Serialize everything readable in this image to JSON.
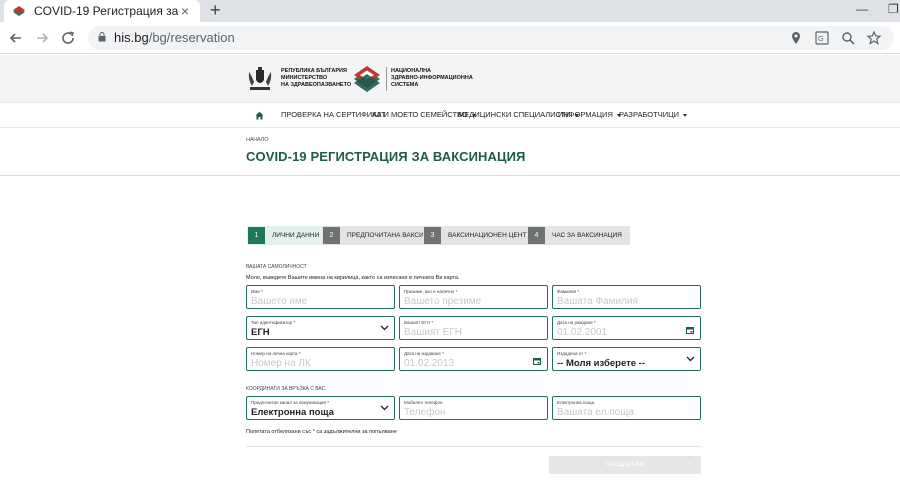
{
  "browser": {
    "tab_title": "COVID-19 Регистрация за вакси",
    "tab_close": "×",
    "new_tab": "+",
    "url_host": "his.bg",
    "url_path": "/bg/reservation",
    "win_min": "—",
    "win_max": "❐"
  },
  "header": {
    "moh_line1": "РЕПУБЛИКА БЪЛГАРИЯ",
    "moh_line2": "МИНИСТЕРСТВО",
    "moh_line3": "НА ЗДРАВЕОПАЗВАНЕТО",
    "nhis_line1": "НАЦИОНАЛНА",
    "nhis_line2": "ЗДРАВНО-ИНФОРМАЦИОННА",
    "nhis_line3": "СИСТЕМА"
  },
  "nav": {
    "items": [
      {
        "label": "ПРОВЕРКА НА СЕРТИФИКАТ"
      },
      {
        "label": "АЗ И МОЕТО СЕМЕЙСТВО"
      },
      {
        "label": "МЕДИЦИНСКИ СПЕЦИАЛИСТИ"
      },
      {
        "label": "ИНФОРМАЦИЯ"
      },
      {
        "label": "РАЗРАБОТЧИЦИ"
      }
    ]
  },
  "page": {
    "breadcrumb": "НАЧАЛО",
    "title": "COVID-19 РЕГИСТРАЦИЯ ЗА ВАКСИНАЦИЯ"
  },
  "steps": [
    {
      "num": "1",
      "label": "ЛИЧНИ ДАННИ"
    },
    {
      "num": "2",
      "label": "ПРЕДПОЧИТАНА ВАКСИНА"
    },
    {
      "num": "3",
      "label": "ВАКСИНАЦИОНЕН ЦЕНТЪР"
    },
    {
      "num": "4",
      "label": "ЧАС ЗА ВАКСИНАЦИЯ"
    }
  ],
  "form": {
    "identity_heading": "ВАШАТА САМОЛИЧНОСТ",
    "hint": "Моля, въведете Вашите имена на кирилица, както са изписани в личната Ви карта.",
    "req_mark": "*",
    "first_name": {
      "label": "Име",
      "placeholder": "Вашето име"
    },
    "middle_name": {
      "label": "Презиме, ако е налично",
      "placeholder": "Вашето презиме"
    },
    "last_name": {
      "label": "Фамилия",
      "placeholder": "Вашата Фамилия"
    },
    "id_type": {
      "label": "Тип идентификатор",
      "value": "ЕГН"
    },
    "egn": {
      "label": "Вашият ЕГН",
      "placeholder": "Вашият ЕГН"
    },
    "birth_date": {
      "label": "Дата на раждане",
      "placeholder": "01.02.2001"
    },
    "id_card": {
      "label": "Номер на лична карта",
      "placeholder": "Номер на ЛК"
    },
    "issue_date": {
      "label": "Дата на издаване",
      "placeholder": "01.02.2013"
    },
    "issued_by": {
      "label": "Издадена от",
      "value": "-- Моля изберете --"
    },
    "contacts_heading": "КООРДИНАТИ ЗА ВРЪЗКА С ВАС",
    "channel": {
      "label": "Предпочитан канал за комуникация",
      "value": "Електронна поща"
    },
    "phone": {
      "label": "Мобилен телефон",
      "placeholder": "Телефон"
    },
    "email": {
      "label": "Електронна поща",
      "placeholder": "Вашата ел.поща"
    },
    "required_note": "Полетата отбелязани със * са задължителни за попълване",
    "next_label": "ПРОДЪЛЖИ",
    "next_arrow": "›"
  },
  "colors": {
    "brand_green": "#1f5a4e",
    "field_border": "#1f6f5a",
    "step_active": "#1b7a5a"
  }
}
